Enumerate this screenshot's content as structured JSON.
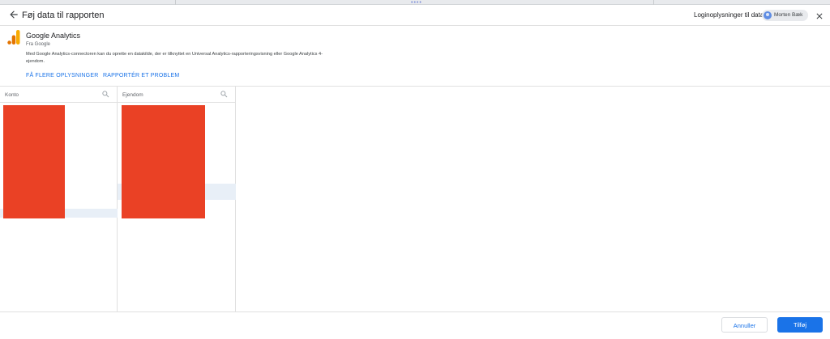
{
  "header": {
    "title": "Føj data til rapporten",
    "credentials_label": "Loginoplysninger til data:",
    "user_name": "Morten Bæk"
  },
  "connector": {
    "name": "Google Analytics",
    "provider": "Fra Google",
    "description": "Med Google Analytics-connectoren kan du oprette en datakilde, der er tilknyttet en Universal Analytics-rapporteringsvisning eller Google Analytics 4-ejendom.",
    "learn_more": "FÅ FLERE OPLYSNINGER",
    "report_problem": "RAPPORTÉR ET PROBLEM",
    "logo_colors": [
      "#f9ab00",
      "#e37400"
    ]
  },
  "columns": [
    {
      "placeholder": "Konto"
    },
    {
      "placeholder": "Ejendom"
    }
  ],
  "footer": {
    "cancel_label": "Annuller",
    "add_label": "Tilføj"
  },
  "colors": {
    "accent": "#1a73e8",
    "redaction": "#ea4125",
    "selected_row": "#e8eff7"
  }
}
